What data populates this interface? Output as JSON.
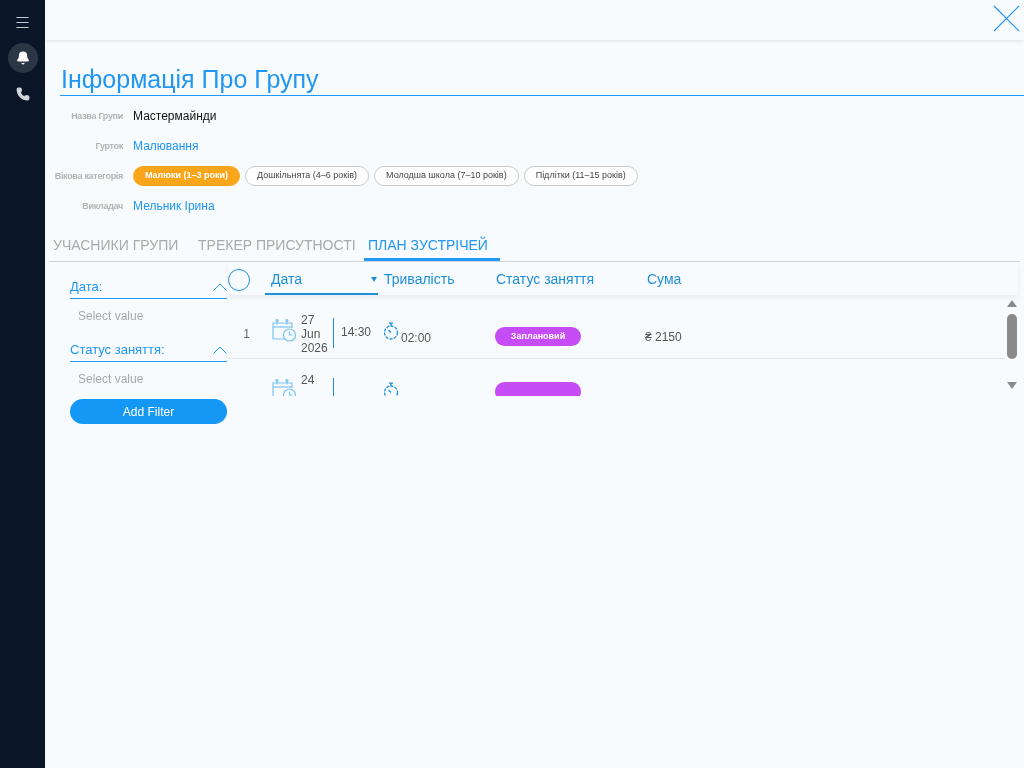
{
  "sidebar": {
    "items": [
      {
        "kind": "menu",
        "selected": false
      },
      {
        "kind": "bell",
        "selected": true
      },
      {
        "kind": "phone",
        "selected": false
      }
    ]
  },
  "title": "Інформація Про Групу",
  "fields": [
    {
      "kind": "text",
      "label": "Назва Групи",
      "value": "Мастермайнди"
    },
    {
      "kind": "link",
      "label": "Гурток",
      "value": "Малювання"
    },
    {
      "kind": "chips",
      "label": "Вікова категорія",
      "options": [
        {
          "label": "Малюки (1–3 роки)",
          "selected": true
        },
        {
          "label": "Дошкільнята (4–6 років)",
          "selected": false
        },
        {
          "label": "Молодша школа (7–10 років)",
          "selected": false
        },
        {
          "label": "Підлітки (11–15 років)",
          "selected": false
        }
      ]
    },
    {
      "kind": "link",
      "label": "Викладач",
      "value": "Мельник Ірина"
    }
  ],
  "tabs": [
    {
      "label": "УЧАСНИКИ ГРУПИ",
      "selected": false
    },
    {
      "label": "ТРЕКЕР ПРИСУТНОСТІ",
      "selected": false
    },
    {
      "label": "ПЛАН ЗУСТРІЧЕЙ",
      "selected": true
    }
  ],
  "filters": {
    "items": [
      {
        "label": "Дата:",
        "placeholder": "Select value"
      },
      {
        "label": "Статус заняття:",
        "placeholder": "Select value"
      }
    ],
    "add_button": "Add Filter"
  },
  "table": {
    "select_all": {
      "checked": false
    },
    "columns": [
      {
        "label": "Дата",
        "sorted": true
      },
      {
        "label": "Тривалість",
        "sorted": false
      },
      {
        "label": "Статус заняття",
        "sorted": false
      },
      {
        "label": "Сума",
        "sorted": false
      }
    ],
    "rows": [
      {
        "number": "1",
        "day": "27",
        "month": "Jun",
        "year": "2026",
        "time": "14:30",
        "duration": "02:00",
        "status": {
          "label": "Заплановий",
          "color": "#c64cf5"
        },
        "sum": "₴ 2150"
      },
      {
        "day": "24",
        "status": {
          "color": "#c64cf5"
        }
      }
    ]
  }
}
